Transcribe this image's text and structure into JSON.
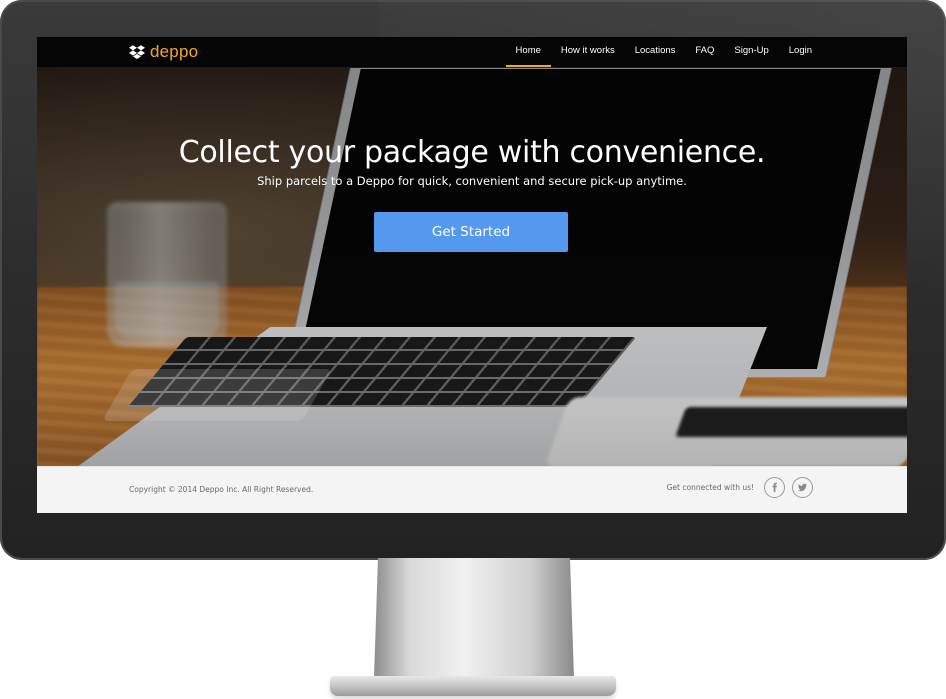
{
  "brand": {
    "name": "deppo",
    "icon": "dropbox-icon",
    "accent_color": "#f5a623"
  },
  "nav": {
    "items": [
      {
        "label": "Home",
        "active": true
      },
      {
        "label": "How it works"
      },
      {
        "label": "Locations"
      },
      {
        "label": "FAQ"
      },
      {
        "label": "Sign-Up"
      },
      {
        "label": "Login"
      }
    ]
  },
  "hero": {
    "title": "Collect your package with convenience.",
    "subtitle": "Ship parcels to a Deppo for quick, convenient and secure pick-up anytime.",
    "cta_label": "Get Started",
    "cta_color": "#5599ee"
  },
  "footer": {
    "copyright": "Copyright © 2014 Deppo Inc. All Right Reserved.",
    "social_label": "Get connected with us!",
    "social": [
      {
        "icon": "facebook-icon"
      },
      {
        "icon": "twitter-icon"
      }
    ]
  }
}
